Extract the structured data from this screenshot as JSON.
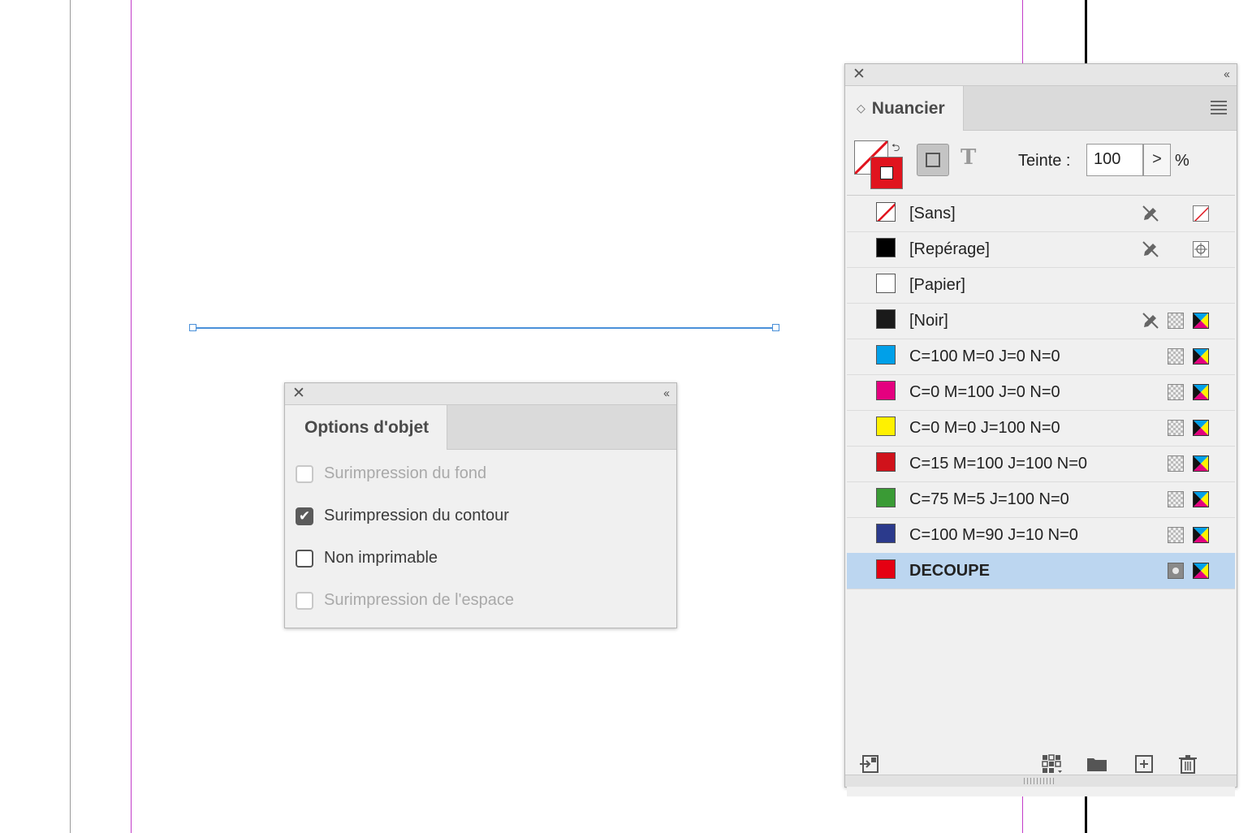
{
  "options_panel": {
    "title": "Options d'objet",
    "close_glyph": "✕",
    "collapse_glyph": "‹‹",
    "options": [
      {
        "label": "Surimpression du fond",
        "checked": false,
        "disabled": true
      },
      {
        "label": "Surimpression du contour",
        "checked": true,
        "disabled": false
      },
      {
        "label": "Non imprimable",
        "checked": false,
        "disabled": false
      },
      {
        "label": "Surimpression de l'espace",
        "checked": false,
        "disabled": true
      }
    ]
  },
  "swatches_panel": {
    "title": "Nuancier",
    "close_glyph": "✕",
    "collapse_glyph": "‹‹",
    "tab_arrow_glyph": "◇",
    "tint_label": "Teinte :",
    "tint_value": "100",
    "tint_arrow": ">",
    "tint_unit": "%",
    "text_mode_glyph": "T",
    "swatches": [
      {
        "name": "[Sans]",
        "color": "none",
        "icons": [
          "pencil-off-icon",
          "none-swatch-icon"
        ]
      },
      {
        "name": "[Repérage]",
        "color": "#000000",
        "icons": [
          "pencil-off-icon",
          "registration-icon"
        ]
      },
      {
        "name": "[Papier]",
        "color": "#ffffff",
        "icons": []
      },
      {
        "name": "[Noir]",
        "color": "#1a1a1a",
        "icons": [
          "pencil-off-icon",
          "process-icon",
          "cmyk-icon"
        ]
      },
      {
        "name": "C=100 M=0 J=0 N=0",
        "color": "#00a0e9",
        "icons": [
          "process-icon",
          "cmyk-icon"
        ]
      },
      {
        "name": "C=0 M=100 J=0 N=0",
        "color": "#e4007f",
        "icons": [
          "process-icon",
          "cmyk-icon"
        ]
      },
      {
        "name": "C=0 M=0 J=100 N=0",
        "color": "#fff100",
        "icons": [
          "process-icon",
          "cmyk-icon"
        ]
      },
      {
        "name": "C=15 M=100 J=100 N=0",
        "color": "#d0121b",
        "icons": [
          "process-icon",
          "cmyk-icon"
        ]
      },
      {
        "name": "C=75 M=5 J=100 N=0",
        "color": "#3a9b35",
        "icons": [
          "process-icon",
          "cmyk-icon"
        ]
      },
      {
        "name": "C=100 M=90 J=10 N=0",
        "color": "#2b3a8c",
        "icons": [
          "process-icon",
          "cmyk-icon"
        ]
      },
      {
        "name": "DECOUPE",
        "color": "#e50012",
        "icons": [
          "spot-icon",
          "cmyk-icon"
        ],
        "selected": true
      }
    ],
    "bottom_icons": [
      "place-swatches-icon",
      "swatch-view-icon",
      "new-group-icon",
      "new-swatch-icon",
      "delete-icon"
    ]
  },
  "colors": {
    "guide_magenta": "#c23cc9",
    "selection_blue": "#4a90d9",
    "selected_row": "#bcd6f0"
  }
}
